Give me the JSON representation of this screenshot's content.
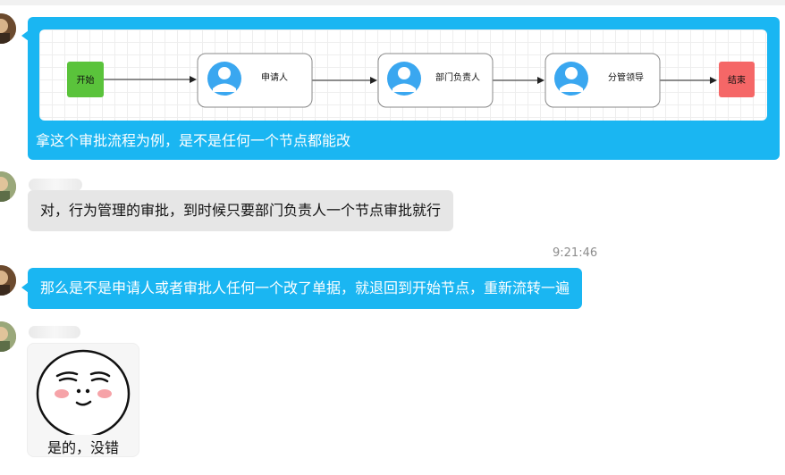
{
  "chat": {
    "messages": [
      {
        "type": "flow_image",
        "flow": {
          "nodes": [
            {
              "label": "开始",
              "kind": "start",
              "color": "#5ac33b"
            },
            {
              "label": "申请人",
              "kind": "person"
            },
            {
              "label": "部门负责人",
              "kind": "person"
            },
            {
              "label": "分管领导",
              "kind": "person"
            },
            {
              "label": "结束",
              "kind": "end",
              "color": "#f56767"
            }
          ]
        },
        "caption": "拿这个审批流程为例，是不是任何一个节点都能改"
      },
      {
        "type": "text",
        "text": "对，行为管理的审批，到时候只要部门负责人一个节点审批就行"
      },
      {
        "type": "timestamp",
        "text": "9:21:46"
      },
      {
        "type": "text",
        "text": "那么是不是申请人或者审批人任何一个改了单据，就退回到开始节点，重新流转一遍"
      },
      {
        "type": "sticker",
        "caption": "是的，没错"
      }
    ]
  },
  "colors": {
    "bubble_blue": "#1ab6f2",
    "bubble_gray": "#e6e6e6",
    "person_icon": "#3aa7f0"
  }
}
